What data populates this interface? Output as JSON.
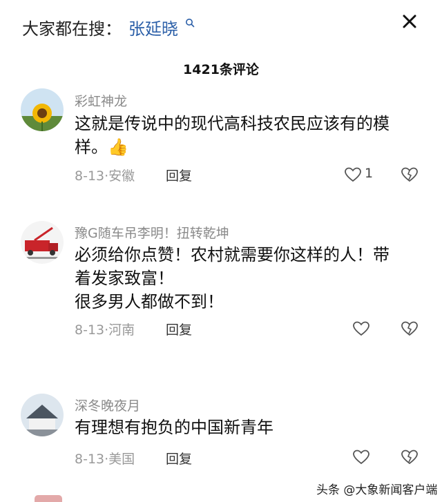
{
  "header": {
    "search_prefix": "大家都在搜：",
    "search_term": "张延晓",
    "search_icon": "search-icon",
    "close_icon": "close-icon"
  },
  "comment_count": "1421条评论",
  "comments": [
    {
      "username": "彩虹神龙",
      "text": "这就是传说中的现代高科技农民应该有的模样。👍",
      "date": "8-13",
      "location": "安徽",
      "reply_label": "回复",
      "likes": "1"
    },
    {
      "username": "豫G随车吊李明！扭转乾坤",
      "text_lines": [
        "必须给你点赞！农村就需要你这样的人！带",
        "着发家致富！",
        "很多男人都做不到！"
      ],
      "date": "8-13",
      "location": "河南",
      "reply_label": "回复"
    },
    {
      "username": "深冬晚夜月",
      "text": "有理想有抱负的中国新青年",
      "date": "8-13",
      "location": "美国",
      "reply_label": "回复"
    }
  ],
  "watermark": "头条 @大象新闻客户端",
  "colors": {
    "link": "#2b5fa8",
    "muted": "#999999",
    "text": "#111111"
  }
}
